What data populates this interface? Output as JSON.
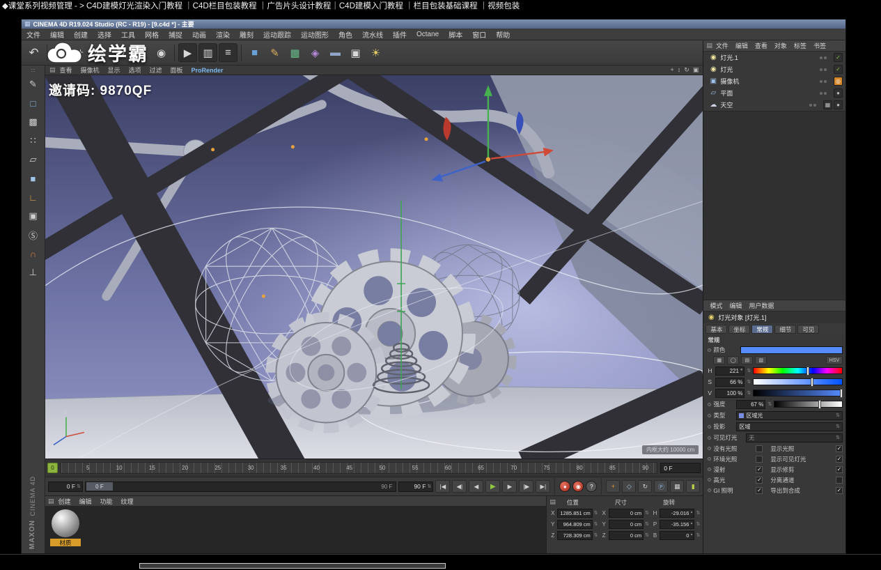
{
  "browser": {
    "breadcrumb": "◆课堂系列视频管理  - > C4D建模灯光渲染入门教程 ｜C4D栏目包装教程 ｜广告片头设计教程｜C4D建模入门教程 ｜栏目包装基础课程 ｜视频包装"
  },
  "icons": {
    "app": "▦",
    "panel_menu": "▤",
    "stepper": "⇅",
    "check": "✓",
    "light": "◉",
    "camera": "▣",
    "floor": "▱",
    "sky": "☁",
    "sphere_tag": "●",
    "checker_tag": "▦",
    "target_tag": "◎"
  },
  "window": {
    "title": "CINEMA 4D R19.024 Studio (RC - R19) - [9.c4d *] - 主要",
    "menu": [
      "文件",
      "编辑",
      "创建",
      "选择",
      "工具",
      "网格",
      "捕捉",
      "动画",
      "渲染",
      "雕刻",
      "运动跟踪",
      "运动图形",
      "角色",
      "流水线",
      "插件",
      "Octane",
      "脚本",
      "窗口",
      "帮助"
    ],
    "brand": [
      "MAXON",
      "CINEMA 4D"
    ]
  },
  "toolbar": {
    "icons": [
      {
        "name": "undo",
        "glyph": "↶"
      },
      {
        "name": "live-selection",
        "glyph": "▭"
      },
      {
        "name": "move",
        "glyph": "+"
      },
      {
        "name": "scale",
        "glyph": "◇"
      },
      {
        "name": "rotate",
        "glyph": "↻"
      },
      {
        "name": "coordinate-globe",
        "glyph": "◎"
      },
      {
        "name": "axis-lock",
        "glyph": "◉"
      },
      {
        "name": "render-view",
        "glyph": "▶"
      },
      {
        "name": "render-picture-viewer",
        "glyph": "▥"
      },
      {
        "name": "render-settings",
        "glyph": "≡"
      },
      {
        "name": "add-cube",
        "glyph": "■"
      },
      {
        "name": "spline-pen",
        "glyph": "✎"
      },
      {
        "name": "subdivision-surface",
        "glyph": "▦"
      },
      {
        "name": "deformer",
        "glyph": "◈"
      },
      {
        "name": "floor-object",
        "glyph": "▬"
      },
      {
        "name": "camera-object",
        "glyph": "▣"
      },
      {
        "name": "light-object",
        "glyph": "☀"
      }
    ]
  },
  "palette": {
    "icons": [
      {
        "name": "palette-handle",
        "glyph": "∷"
      },
      {
        "name": "make-editable",
        "glyph": "✎"
      },
      {
        "name": "model-mode",
        "glyph": "□"
      },
      {
        "name": "texture-mode",
        "glyph": "▩"
      },
      {
        "name": "point-mode",
        "glyph": "∷"
      },
      {
        "name": "edge-mode",
        "glyph": "▱"
      },
      {
        "name": "polygon-mode",
        "glyph": "■"
      },
      {
        "name": "enable-axis",
        "glyph": "∟"
      },
      {
        "name": "viewport-solo",
        "glyph": "▣"
      },
      {
        "name": "snap-settings",
        "glyph": "Ⓢ"
      },
      {
        "name": "enable-snap",
        "glyph": "∩"
      },
      {
        "name": "workplane",
        "glyph": "⊥"
      }
    ]
  },
  "viewport": {
    "menu": [
      "查看",
      "摄像机",
      "显示",
      "选项",
      "过滤",
      "面板"
    ],
    "renderer": "ProRender",
    "right_icons": [
      {
        "name": "pan-view",
        "glyph": "+"
      },
      {
        "name": "zoom-view",
        "glyph": "↕"
      },
      {
        "name": "rotate-view",
        "glyph": "↻"
      },
      {
        "name": "toggle-panel",
        "glyph": "▣"
      }
    ],
    "watermark": "绘学霸",
    "invite_code": "邀请码: 9870QF",
    "scale_text": "内框大约 10000 cm"
  },
  "object_manager": {
    "menu": [
      "文件",
      "编辑",
      "查看",
      "对象",
      "标签",
      "书签"
    ],
    "objects": [
      {
        "name": "灯光.1"
      },
      {
        "name": "灯光"
      },
      {
        "name": "摄像机"
      },
      {
        "name": "平面"
      },
      {
        "name": "天空"
      }
    ]
  },
  "attributes": {
    "menu": [
      "模式",
      "编辑",
      "用户数据"
    ],
    "title": "灯光对象 [灯光.1]",
    "tabs": [
      "基本",
      "坐标",
      "常规",
      "细节",
      "可见"
    ],
    "section": "常规",
    "color_label": "颜色",
    "color_hex": "#578cff",
    "color_modes": [
      "▦",
      "◯",
      "▤",
      "▧"
    ],
    "hsv_mode": "HSV",
    "h_label": "H",
    "h_value": "221 °",
    "s_label": "S",
    "s_value": "66 %",
    "v_label": "V",
    "v_value": "100 %",
    "intensity_label": "强度",
    "intensity_value": "67 %",
    "type_label": "类型",
    "type_value": "区域光",
    "shadow_label": "投影",
    "shadow_value": "区域",
    "visible_label": "可见灯光",
    "visible_value": "无",
    "checks_left": [
      {
        "label": "没有光照",
        "mark": ""
      },
      {
        "label": "环境光照",
        "mark": ""
      },
      {
        "label": "漫射",
        "mark": "✓"
      },
      {
        "label": "高光",
        "mark": "✓"
      },
      {
        "label": "GI 照明",
        "mark": "✓"
      }
    ],
    "checks_right": [
      {
        "label": "显示光照",
        "mark": "✓"
      },
      {
        "label": "显示可见灯光",
        "mark": "✓"
      },
      {
        "label": "显示修剪",
        "mark": "✓"
      },
      {
        "label": "分离通道",
        "mark": ""
      },
      {
        "label": "导出到合成",
        "mark": "✓"
      }
    ]
  },
  "timeline": {
    "playhead": "0",
    "ticks": [
      "5",
      "10",
      "15",
      "20",
      "25",
      "30",
      "35",
      "40",
      "45",
      "50",
      "55",
      "60",
      "65",
      "70",
      "75",
      "80",
      "85",
      "90"
    ],
    "current": "0 F"
  },
  "transport": {
    "current": "0 F",
    "range_start": "0 F",
    "range_end_label": "90 F",
    "end": "90 F",
    "nav": [
      {
        "name": "go-to-start",
        "glyph": "|◀"
      },
      {
        "name": "go-to-previous-key",
        "glyph": "◀|"
      },
      {
        "name": "go-to-previous-frame",
        "glyph": "◀"
      },
      {
        "name": "play-forwards",
        "glyph": "▶"
      },
      {
        "name": "go-to-next-frame",
        "glyph": "▶"
      },
      {
        "name": "go-to-next-key",
        "glyph": "|▶"
      },
      {
        "name": "go-to-end",
        "glyph": "▶|"
      }
    ],
    "record": [
      {
        "name": "record-active-objects",
        "glyph": "●"
      },
      {
        "name": "autokeying",
        "glyph": "◉"
      },
      {
        "name": "keyframe-selection",
        "glyph": "?"
      }
    ],
    "keys": [
      {
        "name": "position-key",
        "glyph": "+"
      },
      {
        "name": "scale-key",
        "glyph": "◇"
      },
      {
        "name": "rotation-key",
        "glyph": "↻"
      },
      {
        "name": "parameter-key",
        "glyph": "Ⓟ"
      },
      {
        "name": "point-level-animation-key",
        "glyph": "▦"
      }
    ],
    "extra": {
      "name": "timeline-mode",
      "glyph": "▮"
    }
  },
  "coordinates": {
    "headers": [
      "位置",
      "尺寸",
      "旋转"
    ],
    "position": [
      {
        "axis": "X",
        "value": "1285.851 cm"
      },
      {
        "axis": "Y",
        "value": "964.809 cm"
      },
      {
        "axis": "Z",
        "value": "728.309 cm"
      }
    ],
    "size": [
      {
        "axis": "X",
        "value": "0 cm"
      },
      {
        "axis": "Y",
        "value": "0 cm"
      },
      {
        "axis": "Z",
        "value": "0 cm"
      }
    ],
    "rotation": [
      {
        "axis": "H",
        "value": "-29.016 °"
      },
      {
        "axis": "P",
        "value": "-35.156 °"
      },
      {
        "axis": "B",
        "value": "0 °"
      }
    ]
  },
  "materials": {
    "menu": [
      "创建",
      "编辑",
      "功能",
      "纹理"
    ],
    "items": [
      {
        "name": "材质"
      }
    ]
  }
}
